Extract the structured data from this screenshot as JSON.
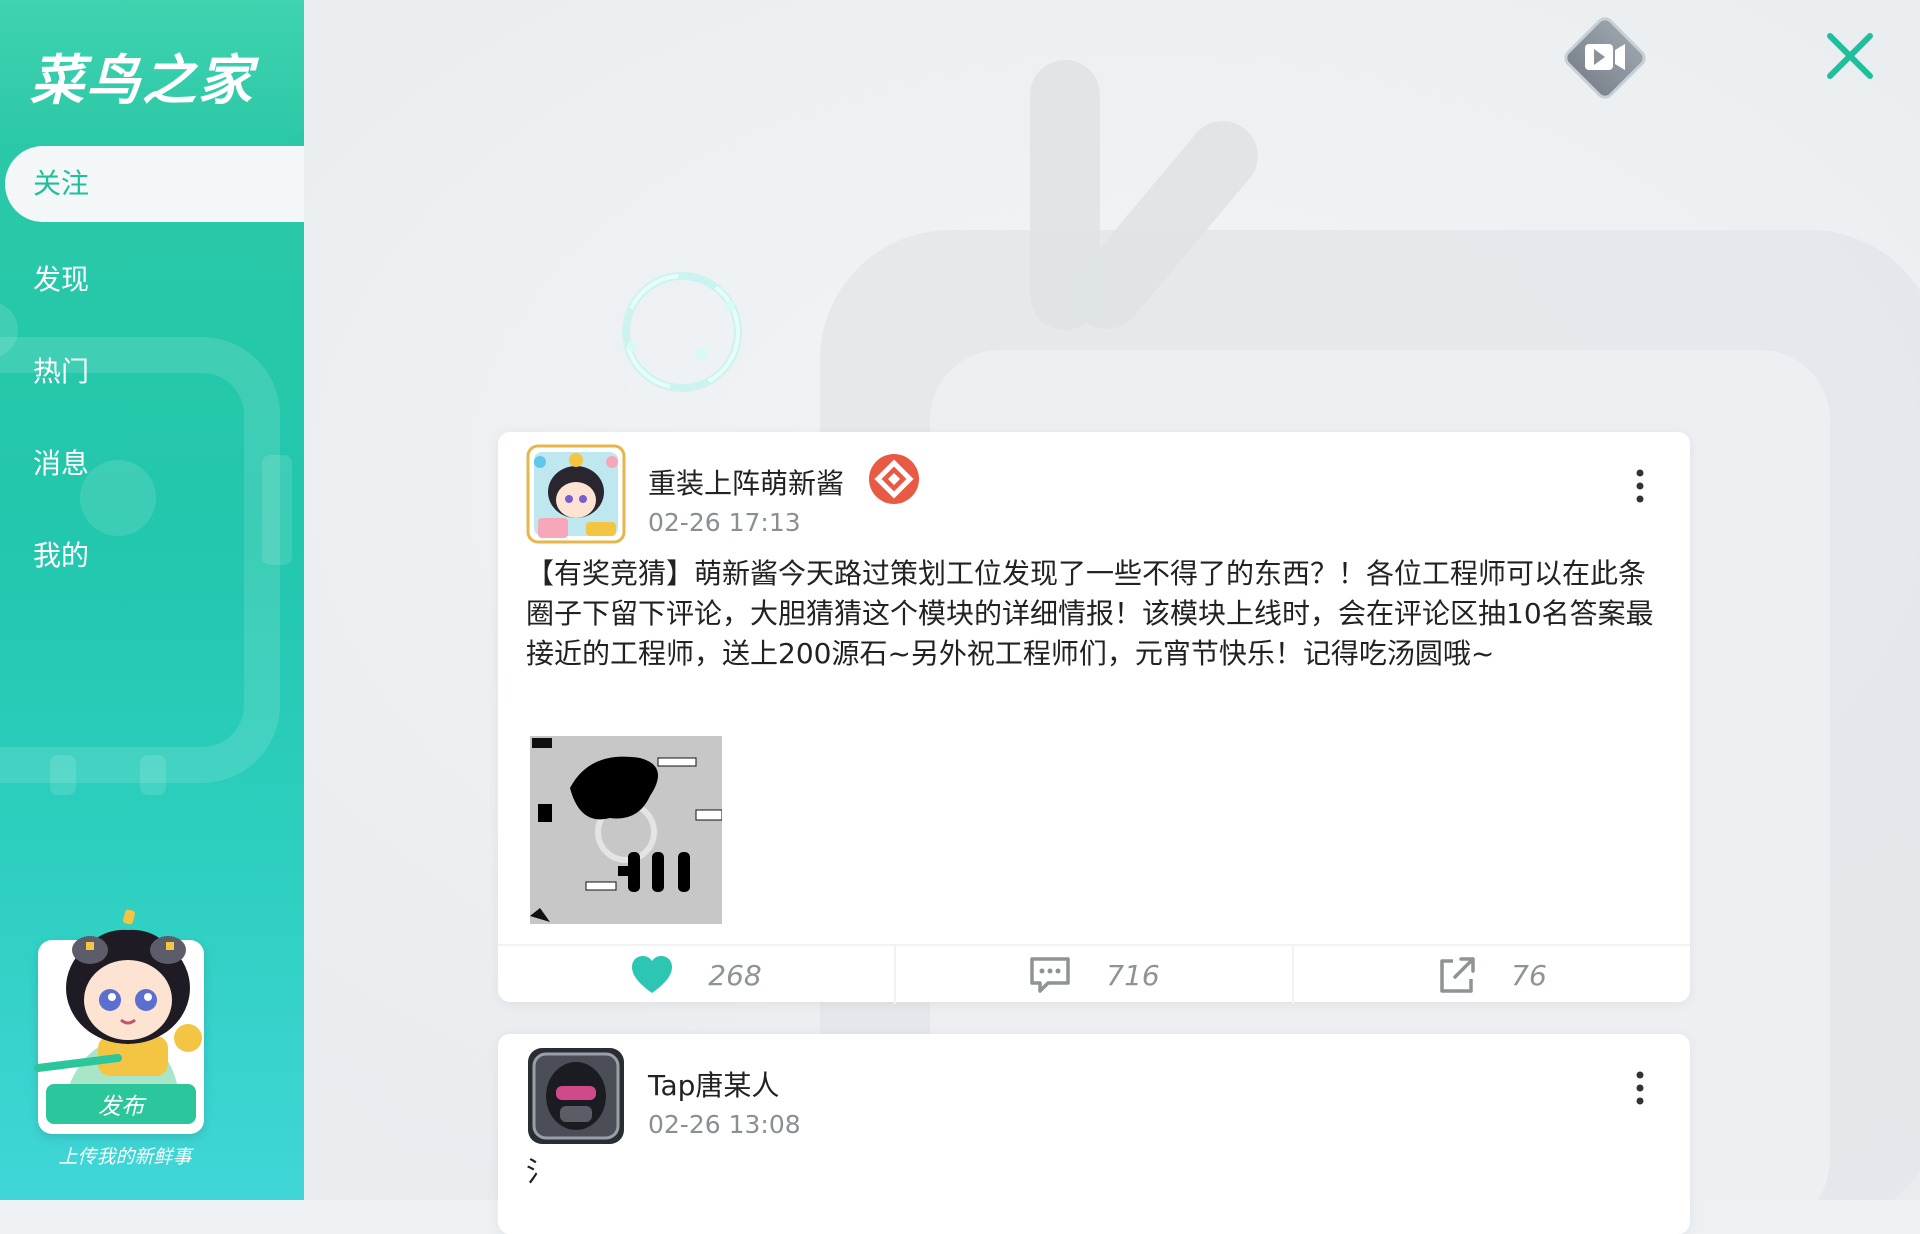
{
  "app": {
    "title": "菜鸟之家"
  },
  "sidebar": {
    "items": [
      {
        "label": "关注",
        "active": true
      },
      {
        "label": "发现",
        "active": false
      },
      {
        "label": "热门",
        "active": false
      },
      {
        "label": "消息",
        "active": false
      },
      {
        "label": "我的",
        "active": false
      }
    ],
    "publish": {
      "button_label": "发布",
      "hint": "上传我的新鲜事"
    }
  },
  "header": {
    "video_icon": "video-camera-icon",
    "close_icon": "close-icon"
  },
  "colors": {
    "accent": "#2cc69c",
    "close": "#1fbf9c",
    "like": "#2cc6b3",
    "badge": "#e95a45"
  },
  "posts": [
    {
      "author": "重装上阵萌新酱",
      "time": "02-26 17:13",
      "badge_icon": "official-badge-icon",
      "text": "【有奖竞猜】萌新酱今天路过策划工位发现了一些不得了的东西？！各位工程师可以在此条圈子下留下评论，大胆猜猜这个模块的详细情报！该模块上线时，会在评论区抽10名答案最接近的工程师，送上200源石~另外祝工程师们，元宵节快乐！记得吃汤圆哦~",
      "likes": "268",
      "comments": "716",
      "shares": "76"
    },
    {
      "author": "Tap唐某人",
      "time": "02-26 13:08",
      "text": "氵"
    }
  ]
}
